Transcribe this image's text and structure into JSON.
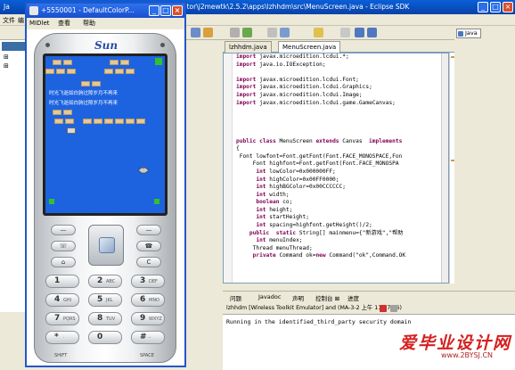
{
  "eclipse": {
    "title_left": "Ja",
    "title_right": "ator\\j2mewtk\\2.5.2\\apps\\lzhhdm\\src\\MenuScreen.java - Eclipse SDK",
    "menu": [
      "文件",
      "编"
    ],
    "left_nodes": [
      "⊞",
      "⊞"
    ],
    "editor_tabs": [
      "lzhhdm.java",
      "MenuScreen.java"
    ],
    "perspective": "Java",
    "code": [
      {
        "t": "import javax.microedition.lcdui.*;",
        "k": "import"
      },
      {
        "t": "import java.io.IOException;",
        "k": "import"
      },
      {
        "t": "",
        "k": ""
      },
      {
        "t": "import javax.microedition.lcdui.Font;",
        "k": "import"
      },
      {
        "t": "import javax.microedition.lcdui.Graphics;",
        "k": "import"
      },
      {
        "t": "import javax.microedition.lcdui.Image;",
        "k": "import"
      },
      {
        "t": "import javax.microedition.lcdui.game.GameCanvas;",
        "k": "import"
      },
      {
        "t": "",
        "k": ""
      },
      {
        "t": "",
        "k": ""
      },
      {
        "t": "",
        "k": ""
      },
      {
        "t": "",
        "k": ""
      },
      {
        "t": "public class MenuScreen extends Canvas  implements",
        "k": "class"
      },
      {
        "t": "{",
        "k": ""
      },
      {
        "t": " Font lowfont=Font.getFont(Font.FACE_MONOSPACE,Fon",
        "k": ""
      },
      {
        "t": "     Font highfont=Font.getFont(Font.FACE_MONOSPA",
        "k": ""
      },
      {
        "t": "      int lowColor=0x000000FF;",
        "k": "int"
      },
      {
        "t": "      int highColor=0x00FF0000;",
        "k": "int"
      },
      {
        "t": "      int highBGColor=0x00CCCCCC;",
        "k": "int"
      },
      {
        "t": "      int width;",
        "k": "int"
      },
      {
        "t": "      boolean co;",
        "k": "boolean"
      },
      {
        "t": "      int height;",
        "k": "int"
      },
      {
        "t": "      int startHeight;",
        "k": "int"
      },
      {
        "t": "      int spacing=highfont.getHeight()/2;",
        "k": "int"
      },
      {
        "t": "    public  static String[] mainmenu={\"新游戏\",\"帮助",
        "k": "public"
      },
      {
        "t": "      int menuIndex;",
        "k": "int"
      },
      {
        "t": "     Thread menuThread;",
        "k": ""
      },
      {
        "t": "     private Command ok=new Command(\"ok\",Command.OK",
        "k": "private"
      }
    ],
    "console_tabs": [
      "问题",
      "Javadoc",
      "声明",
      "控制台 ⊠",
      "进度"
    ],
    "console_header": "lzhhdm [Wireless Toolkit Emulator] and (MA-3-2 上午 11:37:56)",
    "console_line": "Running in the identified_third_party security domain"
  },
  "watermark": {
    "main": "毕业设计网",
    "prefix": "爱",
    "url": "www.2BYSJ.CN"
  },
  "emulator": {
    "title": "+5550001 - DefaultColorP...",
    "menu": [
      "MIDlet",
      "查看",
      "帮助"
    ],
    "brand": "Sun",
    "screen_lines": [
      "时光飞逝如白驹过隙岁月不再来",
      "时光飞逝如白驹过隙岁月不再来"
    ],
    "keys": [
      {
        "n": "1",
        "l": ""
      },
      {
        "n": "2",
        "l": "ABC"
      },
      {
        "n": "3",
        "l": "DEF"
      },
      {
        "n": "4",
        "l": "GHI"
      },
      {
        "n": "5",
        "l": "JKL"
      },
      {
        "n": "6",
        "l": "MNO"
      },
      {
        "n": "7",
        "l": "PQRS"
      },
      {
        "n": "8",
        "l": "TUV"
      },
      {
        "n": "9",
        "l": "WXYZ"
      },
      {
        "n": "*",
        "l": "·"
      },
      {
        "n": "0",
        "l": ""
      },
      {
        "n": "#",
        "l": "-"
      }
    ],
    "key_labels": {
      "shift": "SHIFT",
      "space": "SPACE"
    }
  }
}
